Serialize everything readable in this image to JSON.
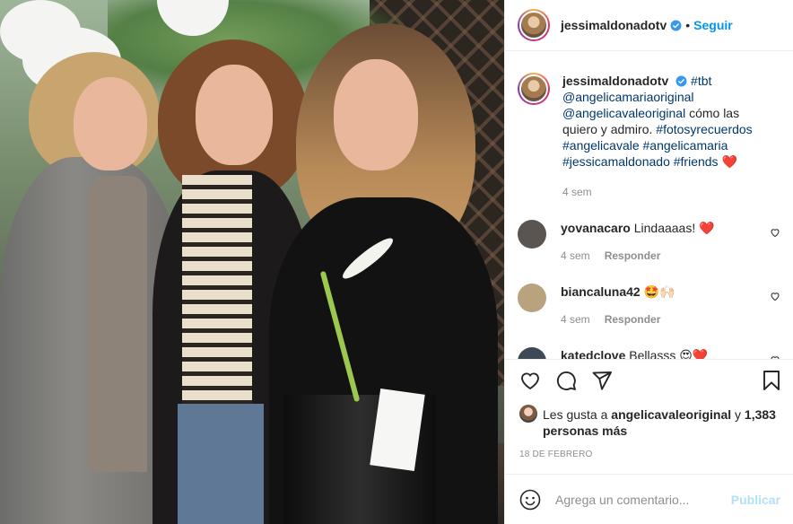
{
  "header": {
    "username": "jessimaldonadotv",
    "separator": "•",
    "follow_label": "Seguir"
  },
  "caption": {
    "username": "jessimaldonadotv",
    "text_1": "#tbt",
    "mention_1": "@angelicamariaoriginal",
    "mention_2": "@angelicavaleoriginal",
    "plain": " cómo las quiero y admiro. ",
    "hashtags": "#fotosyrecuerdos #angelicavale #angelicamaria #jessicamaldonado #friends",
    "emoji": "❤️",
    "time": "4 sem"
  },
  "comments": [
    {
      "username": "yovanacaro",
      "text": "Lindaaaas! ❤️",
      "time": "4 sem",
      "reply": "Responder",
      "avatar_color": "#5a5550"
    },
    {
      "username": "biancaluna42",
      "text": "🤩🙌🏻",
      "time": "4 sem",
      "reply": "Responder",
      "avatar_color": "#b9a27e"
    },
    {
      "username": "katedclove",
      "text": "Bellasss 😍❤️",
      "time": "",
      "reply": "",
      "avatar_color": "#3d4a55"
    }
  ],
  "likes": {
    "prefix": "Les gusta a ",
    "user": "angelicavaleoriginal",
    "middle": " y ",
    "count": "1,383 personas más"
  },
  "date": "18 de febrero",
  "add_comment": {
    "placeholder": "Agrega un comentario...",
    "post_label": "Publicar"
  },
  "colors": {
    "link_blue": "#0095f6",
    "tag_blue": "#00376b",
    "muted": "#8e8e8e",
    "post_disabled": "#b2dffc"
  }
}
